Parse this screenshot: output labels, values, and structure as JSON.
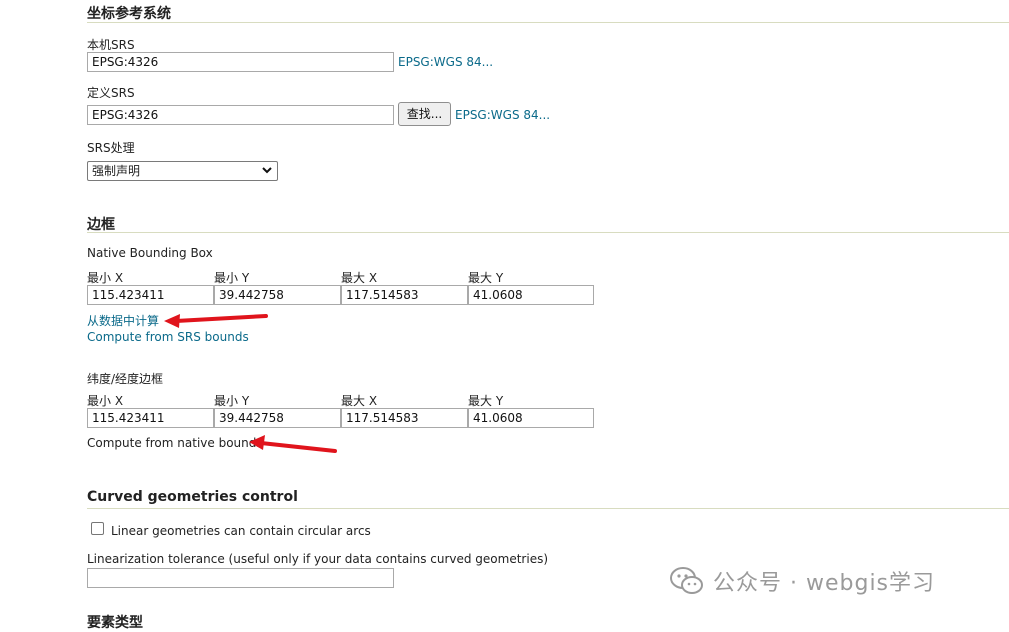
{
  "crs": {
    "title": "坐标参考系统",
    "native_label": "本机SRS",
    "native_value": "EPSG:4326",
    "native_link": "EPSG:WGS 84...",
    "declared_label": "定义SRS",
    "declared_value": "EPSG:4326",
    "find_button": "查找...",
    "declared_link": "EPSG:WGS 84...",
    "handling_label": "SRS处理",
    "handling_value": "强制声明"
  },
  "bbox": {
    "title": "边框",
    "native": {
      "label": "Native Bounding Box",
      "headers": [
        "最小 X",
        "最小 Y",
        "最大 X",
        "最大 Y"
      ],
      "values": [
        "115.423411",
        "39.442758",
        "117.514583",
        "41.0608"
      ],
      "compute_data_link": "从数据中计算",
      "compute_srs_link": "Compute from SRS bounds"
    },
    "latlon": {
      "label": "纬度/经度边框",
      "headers": [
        "最小 X",
        "最小 Y",
        "最大 X",
        "最大 Y"
      ],
      "values": [
        "115.423411",
        "39.442758",
        "117.514583",
        "41.0608"
      ],
      "compute_native_link": "Compute from native bounds"
    }
  },
  "curved": {
    "title": "Curved geometries control",
    "checkbox_label": "Linear geometries can contain circular arcs",
    "checkbox_checked": false,
    "tolerance_label": "Linearization tolerance (useful only if your data contains curved geometries)",
    "tolerance_value": ""
  },
  "next_section": {
    "title": "要素类型"
  },
  "watermark": {
    "text": "公众号 · webgis学习"
  },
  "annotations": {
    "arrow_color": "#e0141c"
  }
}
